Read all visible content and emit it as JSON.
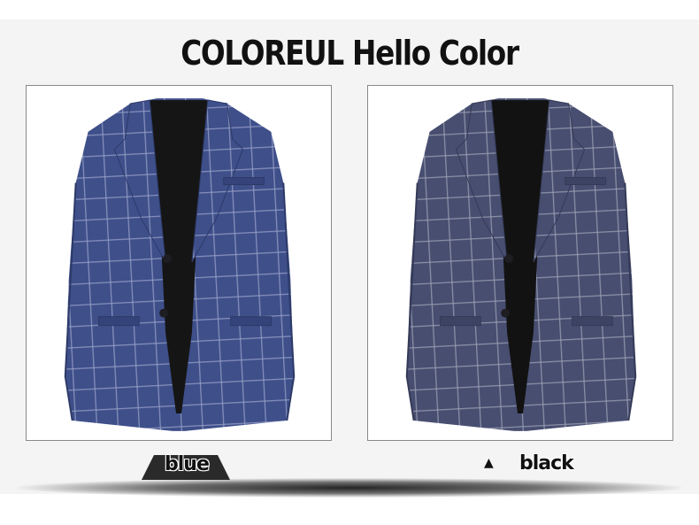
{
  "page": {
    "title": "COLOREUL Hello Color"
  },
  "products": [
    {
      "label": "blue",
      "color": "#3e4f8a",
      "grid": "#9aa3c8",
      "icon": "blazer-icon"
    },
    {
      "label": "black",
      "color": "#474e70",
      "grid": "#a0a3b6",
      "icon": "blazer-icon"
    }
  ],
  "markers": {
    "triangle": "▲"
  }
}
